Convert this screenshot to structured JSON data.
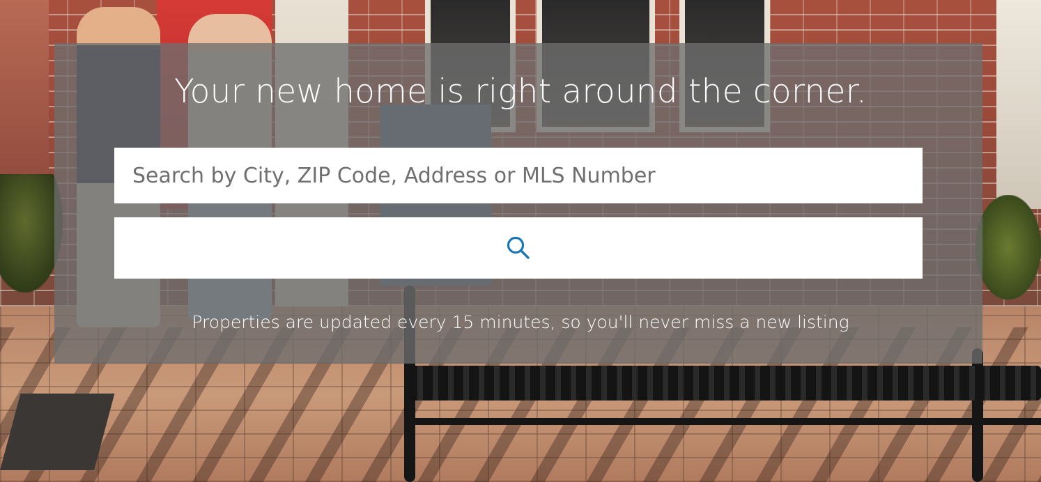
{
  "hero": {
    "headline": "Your new home is right around the corner.",
    "subtext": "Properties are updated every 15 minutes, so you'll never miss a new listing"
  },
  "search": {
    "placeholder": "Search by City, ZIP Code, Address or MLS Number",
    "value": "",
    "button_icon": "search-icon"
  },
  "colors": {
    "accent": "#1a77b5",
    "panel_overlay": "rgba(110,110,110,0.78)",
    "text_on_panel": "#ffffff"
  }
}
